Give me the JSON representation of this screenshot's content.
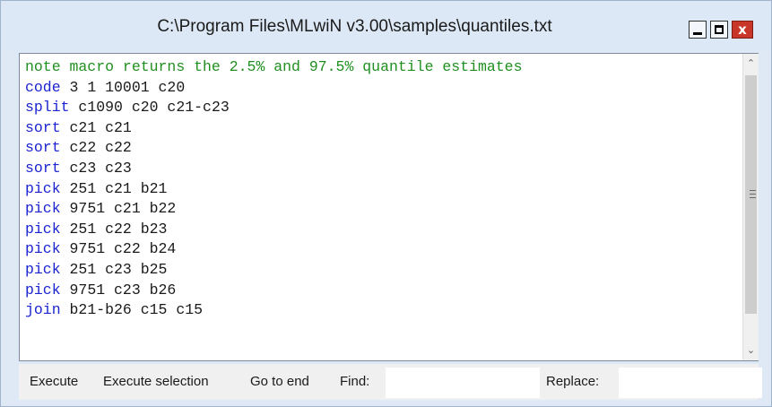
{
  "window": {
    "title": "C:\\Program Files\\MLwiN v3.00\\samples\\quantiles.txt",
    "controls": {
      "minimize_icon": "minimize-icon",
      "maximize_icon": "maximize-icon",
      "close_glyph": "x"
    }
  },
  "editor": {
    "lines": [
      {
        "keyword": "note macro returns the 2.5% and 97.5% quantile estimates",
        "rest": "",
        "type": "comment"
      },
      {
        "keyword": "code",
        "rest": " 3 1 10001 c20",
        "type": "command"
      },
      {
        "keyword": "split",
        "rest": " c1090 c20 c21-c23",
        "type": "command"
      },
      {
        "keyword": "sort",
        "rest": " c21 c21",
        "type": "command"
      },
      {
        "keyword": "sort",
        "rest": " c22 c22",
        "type": "command"
      },
      {
        "keyword": "sort",
        "rest": " c23 c23",
        "type": "command"
      },
      {
        "keyword": "pick",
        "rest": " 251 c21 b21",
        "type": "command"
      },
      {
        "keyword": "pick",
        "rest": " 9751 c21 b22",
        "type": "command"
      },
      {
        "keyword": "pick",
        "rest": " 251 c22 b23",
        "type": "command"
      },
      {
        "keyword": "pick",
        "rest": " 9751 c22 b24",
        "type": "command"
      },
      {
        "keyword": "pick",
        "rest": " 251 c23 b25",
        "type": "command"
      },
      {
        "keyword": "pick",
        "rest": " 9751 c23 b26",
        "type": "command"
      },
      {
        "keyword": "join",
        "rest": " b21-b26 c15 c15",
        "type": "command"
      }
    ],
    "colors": {
      "keyword": "#1b24d0",
      "comment": "#1f8f1f",
      "text": "#1a1a1a"
    }
  },
  "toolbar": {
    "execute": "Execute",
    "execute_selection": "Execute selection",
    "go_to_end": "Go to end",
    "find_label": "Find:",
    "find_value": "",
    "replace_label": "Replace:",
    "replace_value": ""
  }
}
